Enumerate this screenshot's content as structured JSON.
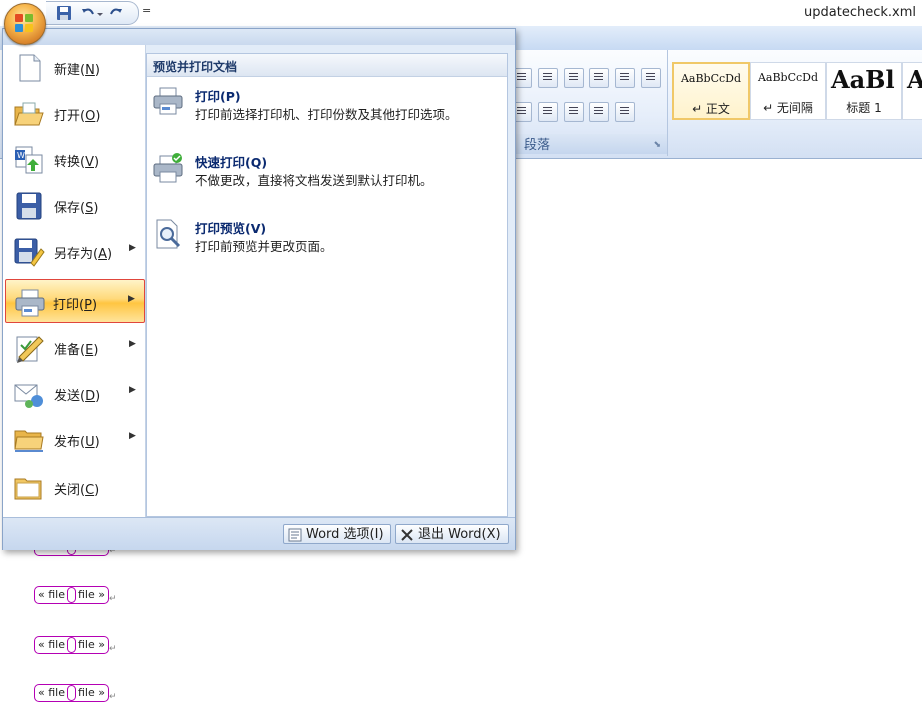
{
  "window": {
    "title": "updatecheck.xml"
  },
  "qat": {
    "more": "="
  },
  "ribbon": {
    "paragraph_group_label": "段落",
    "styles": [
      {
        "sample": "AaBbCcDd",
        "name": "↵ 正文",
        "selected": true
      },
      {
        "sample": "AaBbCcDd",
        "name": "↵ 无间隔",
        "selected": false
      },
      {
        "sample": "AaBl",
        "name": "标题 1",
        "selected": false
      },
      {
        "sample": "A",
        "name": "",
        "selected": false
      }
    ]
  },
  "office_menu": {
    "items": [
      {
        "label": "新建",
        "key": "N",
        "icon": "new-document-icon",
        "has_submenu": false
      },
      {
        "label": "打开",
        "key": "O",
        "icon": "open-folder-icon",
        "has_submenu": false
      },
      {
        "label": "转换",
        "key": "V",
        "icon": "convert-icon",
        "has_submenu": false
      },
      {
        "label": "保存",
        "key": "S",
        "icon": "save-disk-icon",
        "has_submenu": false
      },
      {
        "label": "另存为",
        "key": "A",
        "icon": "save-as-icon",
        "has_submenu": true
      },
      {
        "label": "打印",
        "key": "P",
        "icon": "printer-icon",
        "has_submenu": true,
        "active": true
      },
      {
        "label": "准备",
        "key": "E",
        "icon": "prepare-pencil-icon",
        "has_submenu": true
      },
      {
        "label": "发送",
        "key": "D",
        "icon": "send-icon",
        "has_submenu": true
      },
      {
        "label": "发布",
        "key": "U",
        "icon": "publish-folder-icon",
        "has_submenu": true
      },
      {
        "label": "关闭",
        "key": "C",
        "icon": "close-folder-icon",
        "has_submenu": false
      }
    ],
    "submenu": {
      "heading": "预览并打印文档",
      "items": [
        {
          "title": "打印(P)",
          "desc": "打印前选择打印机、打印份数及其他打印选项。",
          "icon": "printer-icon"
        },
        {
          "title": "快速打印(Q)",
          "desc": "不做更改，直接将文档发送到默认打印机。",
          "icon": "quick-print-icon"
        },
        {
          "title": "打印预览(V)",
          "desc": "打印前预览并更改页面。",
          "icon": "print-preview-icon"
        }
      ]
    },
    "footer": {
      "options_label": "Word 选项(I)",
      "exit_label": "退出 Word(X)"
    }
  },
  "document": {
    "field_text_left": "« file",
    "field_text_right": "file »",
    "lines": 4
  }
}
